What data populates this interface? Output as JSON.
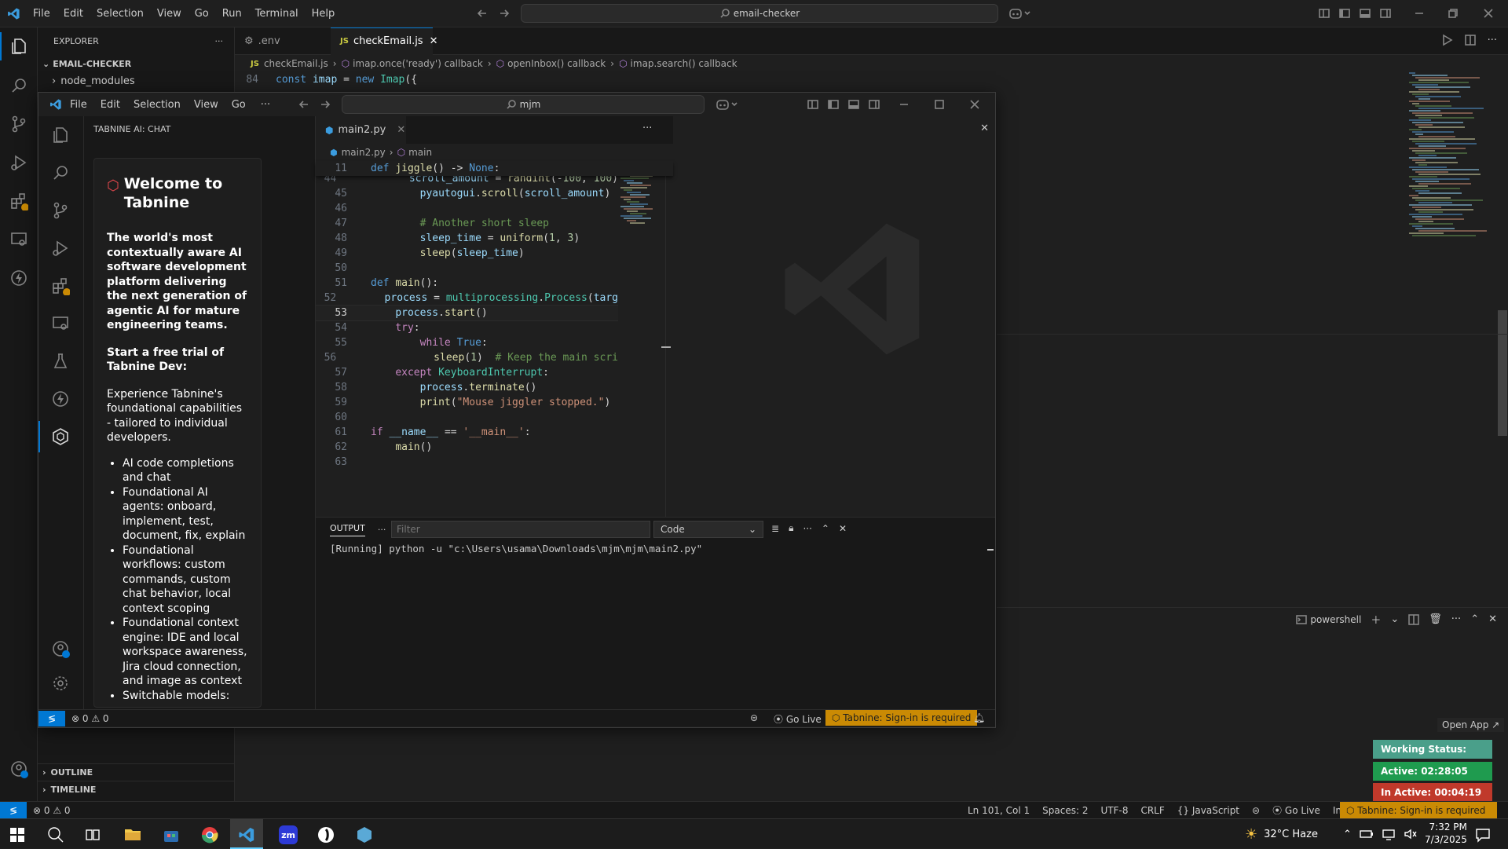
{
  "outer": {
    "menu": [
      "File",
      "Edit",
      "Selection",
      "View",
      "Go",
      "Run",
      "Terminal",
      "Help"
    ],
    "search": "email-checker",
    "tabs": [
      {
        "label": ".env",
        "icon": "gear-icon"
      },
      {
        "label": "checkEmail.js",
        "icon": "JS"
      }
    ],
    "breadcrumb": [
      "checkEmail.js",
      "imap.once('ready') callback",
      "openInbox() callback",
      "imap.search() callback"
    ],
    "code_line_no": "84",
    "explorer": {
      "title": "EXPLORER",
      "root": "EMAIL-CHECKER",
      "folder": "node_modules",
      "outline": "OUTLINE",
      "timeline": "TIMELINE"
    },
    "status": {
      "errors": "0",
      "warnings": "0",
      "position": "Ln 101, Col 1",
      "spaces": "Spaces: 2",
      "encoding": "UTF-8",
      "eol": "CRLF",
      "language": "JavaScript",
      "golive": "Go Live",
      "mode": "Insert",
      "tabnine": "Tabnine: Sign-in is required"
    },
    "powershell": "powershell"
  },
  "inner": {
    "menu": [
      "File",
      "Edit",
      "Selection",
      "View",
      "Go"
    ],
    "search": "mjm",
    "sidebar_title": "TABNINE AI: CHAT",
    "tab": "main2.py",
    "breadcrumb": [
      "main2.py",
      "main"
    ],
    "sticky_line": {
      "no": "11",
      "text": "def jiggle() -> None:"
    },
    "code": [
      {
        "no": "44",
        "html": "        <span class='vr'>scroll_amount</span> <span class='tx'>=</span> <span class='fn'>randint</span><span class='tx'>(-</span><span class='nm'>100</span><span class='tx'>, </span><span class='nm'>100</span><span class='tx'>)</span>"
      },
      {
        "no": "45",
        "html": "        <span class='vr'>pyautogui</span><span class='tx'>.</span><span class='fn'>scroll</span><span class='tx'>(</span><span class='vr'>scroll_amount</span><span class='tx'>)</span>"
      },
      {
        "no": "46",
        "html": ""
      },
      {
        "no": "47",
        "html": "        <span class='cm'># Another short sleep</span>"
      },
      {
        "no": "48",
        "html": "        <span class='vr'>sleep_time</span> <span class='tx'>=</span> <span class='fn'>uniform</span><span class='tx'>(</span><span class='nm'>1</span><span class='tx'>, </span><span class='nm'>3</span><span class='tx'>)</span>"
      },
      {
        "no": "49",
        "html": "        <span class='fn'>sleep</span><span class='tx'>(</span><span class='vr'>sleep_time</span><span class='tx'>)</span>"
      },
      {
        "no": "50",
        "html": ""
      },
      {
        "no": "51",
        "html": "<span class='kw'>def</span> <span class='fn'>main</span><span class='tx'>():</span>"
      },
      {
        "no": "52",
        "html": "    <span class='vr'>process</span> <span class='tx'>=</span> <span class='cl'>multiprocessing</span><span class='tx'>.</span><span class='cl'>Process</span><span class='tx'>(</span><span class='vr'>targ</span>"
      },
      {
        "no": "53",
        "html": "    <span class='vr'>process</span><span class='tx'>.</span><span class='fn'>start</span><span class='tx'>()</span>"
      },
      {
        "no": "54",
        "html": "    <span class='kw2'>try</span><span class='tx'>:</span>"
      },
      {
        "no": "55",
        "html": "        <span class='kw2'>while</span> <span class='kw'>True</span><span class='tx'>:</span>"
      },
      {
        "no": "56",
        "html": "            <span class='fn'>sleep</span><span class='tx'>(</span><span class='nm'>1</span><span class='tx'>)  </span><span class='cm'># Keep the main scri</span>"
      },
      {
        "no": "57",
        "html": "    <span class='kw2'>except</span> <span class='cl'>KeyboardInterrupt</span><span class='tx'>:</span>"
      },
      {
        "no": "58",
        "html": "        <span class='vr'>process</span><span class='tx'>.</span><span class='fn'>terminate</span><span class='tx'>()</span>"
      },
      {
        "no": "59",
        "html": "        <span class='fn'>print</span><span class='tx'>(</span><span class='st'>\"Mouse jiggler stopped.\"</span><span class='tx'>)</span>"
      },
      {
        "no": "60",
        "html": ""
      },
      {
        "no": "61",
        "html": "<span class='kw2'>if</span> <span class='vr'>__name__</span> <span class='tx'>==</span> <span class='st'>'__main__'</span><span class='tx'>:</span>"
      },
      {
        "no": "62",
        "html": "    <span class='fn'>main</span><span class='tx'>()</span>"
      },
      {
        "no": "63",
        "html": ""
      }
    ],
    "welcome": {
      "title": "Welcome to Tabnine",
      "intro": "The world's most contextually aware AI software development platform delivering the next generation of agentic AI for mature engineering teams.",
      "trial": "Start a free trial of Tabnine Dev:",
      "desc": "Experience Tabnine's foundational capabilities - tailored to individual developers.",
      "bullets": [
        "AI code completions and chat",
        "Foundational AI agents: onboard, implement, test, document, fix, explain",
        "Foundational workflows: custom commands, custom chat behavior, local context scoping",
        "Foundational context engine: IDE and local workspace awareness, Jira cloud connection, and image as context",
        "Switchable models:"
      ]
    },
    "panel": {
      "tab": "OUTPUT",
      "filter_placeholder": "Filter",
      "channel": "Code",
      "output": "[Running] python -u \"c:\\Users\\usama\\Downloads\\mjm\\mjm\\main2.py\""
    },
    "status": {
      "errors": "0",
      "warnings": "0",
      "golive": "Go Live",
      "tabnine": "Tabnine: Sign-in is required"
    }
  },
  "tracker": {
    "open_app": "Open App ↗",
    "working": "Working Status: Active",
    "active": "Active: 02:28:05",
    "inactive": "In Active: 00:04:19"
  },
  "taskbar": {
    "weather": "32°C  Haze",
    "time": "7:32 PM",
    "date": "7/3/2025"
  },
  "colors": {
    "accent": "#0078d4",
    "tabnine": "#ca8a04",
    "working": "#4a9f8a",
    "active": "#1f9b4f",
    "inactive": "#c0392b"
  }
}
